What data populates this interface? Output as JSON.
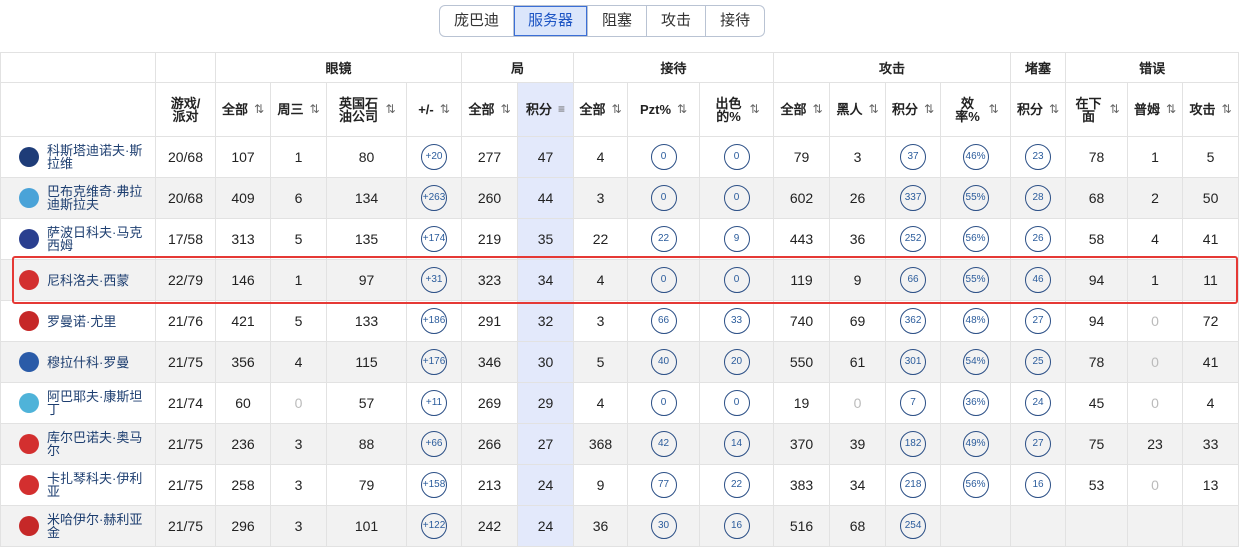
{
  "tabs": [
    "庞巴迪",
    "服务器",
    "阻塞",
    "攻击",
    "接待"
  ],
  "active_tab": 1,
  "groups": [
    {
      "label": "",
      "span": 2
    },
    {
      "label": "眼镜",
      "span": 4
    },
    {
      "label": "局",
      "span": 2
    },
    {
      "label": "接待",
      "span": 3
    },
    {
      "label": "攻击",
      "span": 4
    },
    {
      "label": "堵塞",
      "span": 1
    },
    {
      "label": "错误",
      "span": 3
    }
  ],
  "columns": [
    "游戏/派对",
    "全部",
    "周三",
    "英国石油公司",
    "+/-",
    "全部",
    "积分",
    "全部",
    "Pzt%",
    "出色的%",
    "全部",
    "黑人",
    "积分",
    "效率%",
    "积分",
    "在下面",
    "普姆",
    "攻击"
  ],
  "rows": [
    {
      "name": "科斯塔迪诺夫·斯拉维",
      "logo": "#1e3c78",
      "v": [
        "20/68",
        "107",
        "1",
        "80",
        "+20",
        "277",
        "47",
        "4",
        "0",
        "0",
        "79",
        "3",
        "37",
        "46%",
        "23",
        "78",
        "1",
        "5"
      ]
    },
    {
      "name": "巴布克维奇·弗拉迪斯拉夫",
      "logo": "#4aa3d8",
      "v": [
        "20/68",
        "409",
        "6",
        "134",
        "+263",
        "260",
        "44",
        "3",
        "0",
        "0",
        "602",
        "26",
        "337",
        "55%",
        "28",
        "68",
        "2",
        "50"
      ]
    },
    {
      "name": "萨波日科夫·马克西姆",
      "logo": "#2a3f8f",
      "v": [
        "17/58",
        "313",
        "5",
        "135",
        "+174",
        "219",
        "35",
        "22",
        "22",
        "9",
        "443",
        "36",
        "252",
        "56%",
        "26",
        "58",
        "4",
        "41"
      ]
    },
    {
      "name": "尼科洛夫·西蒙",
      "logo": "#d32f2f",
      "v": [
        "22/79",
        "146",
        "1",
        "97",
        "+31",
        "323",
        "34",
        "4",
        "0",
        "0",
        "119",
        "9",
        "66",
        "55%",
        "46",
        "94",
        "1",
        "11"
      ]
    },
    {
      "name": "罗曼诺·尤里",
      "logo": "#c62828",
      "v": [
        "21/76",
        "421",
        "5",
        "133",
        "+186",
        "291",
        "32",
        "3",
        "66",
        "33",
        "740",
        "69",
        "362",
        "48%",
        "27",
        "94",
        "0",
        "72"
      ]
    },
    {
      "name": "穆拉什科·罗曼",
      "logo": "#2a5ba8",
      "v": [
        "21/75",
        "356",
        "4",
        "115",
        "+176",
        "346",
        "30",
        "5",
        "40",
        "20",
        "550",
        "61",
        "301",
        "54%",
        "25",
        "78",
        "0",
        "41"
      ]
    },
    {
      "name": "阿巴耶夫·康斯坦丁",
      "logo": "#4fb3d9",
      "v": [
        "21/74",
        "60",
        "0",
        "57",
        "+11",
        "269",
        "29",
        "4",
        "0",
        "0",
        "19",
        "0",
        "7",
        "36%",
        "24",
        "45",
        "0",
        "4"
      ]
    },
    {
      "name": "库尔巴诺夫·奥马尔",
      "logo": "#d32f2f",
      "v": [
        "21/75",
        "236",
        "3",
        "88",
        "+66",
        "266",
        "27",
        "368",
        "42",
        "14",
        "370",
        "39",
        "182",
        "49%",
        "27",
        "75",
        "23",
        "33"
      ]
    },
    {
      "name": "卡扎琴科夫·伊利亚",
      "logo": "#d32f2f",
      "v": [
        "21/75",
        "258",
        "3",
        "79",
        "+158",
        "213",
        "24",
        "9",
        "77",
        "22",
        "383",
        "34",
        "218",
        "56%",
        "16",
        "53",
        "0",
        "13"
      ]
    },
    {
      "name": "米哈伊尔·赫利亚金",
      "logo": "#c62828",
      "v": [
        "21/75",
        "296",
        "3",
        "101",
        "+122",
        "242",
        "24",
        "36",
        "30",
        "16",
        "516",
        "68",
        "254",
        "",
        "",
        "",
        "",
        ""
      ]
    }
  ]
}
